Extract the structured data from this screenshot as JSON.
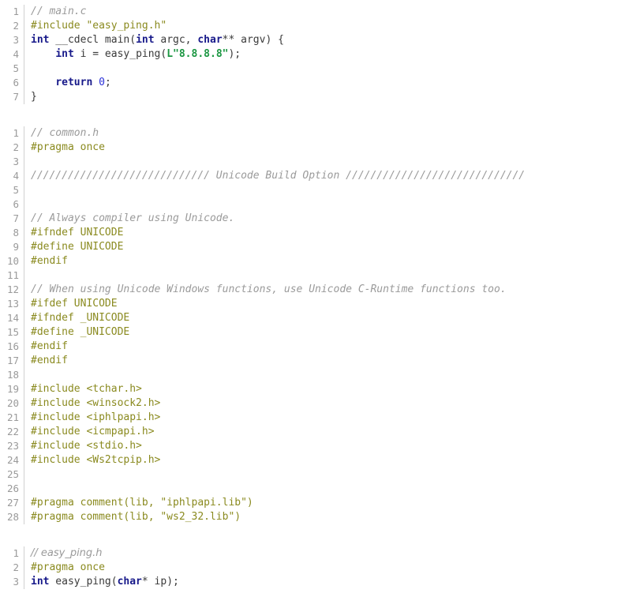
{
  "document": {
    "type": "source-code-listing",
    "language": "c",
    "background_color": "#ffffff",
    "theme": {
      "comment_color": "#9a9a9a",
      "preprocessor_color": "#8a8a1f",
      "keyword_color": "#17198a",
      "string_color": "#1a9641",
      "number_color": "#2a30d8",
      "plain_color": "#3a3a3a",
      "gutter_color": "#9a9a9a",
      "divider_color": "#d0d0d0"
    }
  },
  "blocks": [
    {
      "id": "block-main-c",
      "file_label": "main.c",
      "line_numbers": [
        "1",
        "2",
        "3",
        "4",
        "5",
        "6",
        "7"
      ],
      "lines": [
        {
          "number": "1",
          "text": "// main.c",
          "tokens": [
            {
              "t": "// main.c",
              "k": "comment"
            }
          ]
        },
        {
          "number": "2",
          "text": "#include \"easy_ping.h\"",
          "tokens": [
            {
              "t": "#include \"easy_ping.h\"",
              "k": "preproc"
            }
          ]
        },
        {
          "number": "3",
          "text": "int __cdecl main(int argc, char** argv) {",
          "tokens": [
            {
              "t": "int",
              "k": "keyword"
            },
            {
              "t": " __cdecl main(",
              "k": "plain"
            },
            {
              "t": "int",
              "k": "keyword"
            },
            {
              "t": " argc, ",
              "k": "plain"
            },
            {
              "t": "char",
              "k": "keyword"
            },
            {
              "t": "** argv) {",
              "k": "plain"
            }
          ]
        },
        {
          "number": "4",
          "text": "    int i = easy_ping(L\"8.8.8.8\");",
          "tokens": [
            {
              "t": "    ",
              "k": "plain"
            },
            {
              "t": "int",
              "k": "keyword"
            },
            {
              "t": " i = easy_ping(",
              "k": "plain"
            },
            {
              "t": "L\"8.8.8.8\"",
              "k": "string"
            },
            {
              "t": ");",
              "k": "plain"
            }
          ]
        },
        {
          "number": "5",
          "text": "",
          "tokens": []
        },
        {
          "number": "6",
          "text": "    return 0;",
          "tokens": [
            {
              "t": "    ",
              "k": "plain"
            },
            {
              "t": "return",
              "k": "keyword"
            },
            {
              "t": " ",
              "k": "plain"
            },
            {
              "t": "0",
              "k": "number"
            },
            {
              "t": ";",
              "k": "plain"
            }
          ]
        },
        {
          "number": "7",
          "text": "}",
          "tokens": [
            {
              "t": "}",
              "k": "plain"
            }
          ]
        }
      ]
    },
    {
      "id": "block-common-h",
      "file_label": "common.h",
      "line_numbers": [
        "1",
        "2",
        "3",
        "4",
        "5",
        "6",
        "7",
        "8",
        "9",
        "10",
        "11",
        "12",
        "13",
        "14",
        "15",
        "16",
        "17",
        "18",
        "19",
        "20",
        "21",
        "22",
        "23",
        "24",
        "25",
        "26",
        "27",
        "28"
      ],
      "lines": [
        {
          "number": "1",
          "text": "// common.h",
          "tokens": [
            {
              "t": "// common.h",
              "k": "comment"
            }
          ]
        },
        {
          "number": "2",
          "text": "#pragma once",
          "tokens": [
            {
              "t": "#pragma once",
              "k": "preproc"
            }
          ]
        },
        {
          "number": "3",
          "text": "",
          "tokens": []
        },
        {
          "number": "4",
          "text": "///////////////////////////// Unicode Build Option /////////////////////////////",
          "tokens": [
            {
              "t": "///////////////////////////// Unicode Build Option /////////////////////////////",
              "k": "comment"
            }
          ]
        },
        {
          "number": "5",
          "text": "",
          "tokens": []
        },
        {
          "number": "6",
          "text": "",
          "tokens": []
        },
        {
          "number": "7",
          "text": "// Always compiler using Unicode.",
          "tokens": [
            {
              "t": "// Always compiler using Unicode.",
              "k": "comment"
            }
          ]
        },
        {
          "number": "8",
          "text": "#ifndef UNICODE",
          "tokens": [
            {
              "t": "#ifndef UNICODE",
              "k": "preproc"
            }
          ]
        },
        {
          "number": "9",
          "text": "#define UNICODE",
          "tokens": [
            {
              "t": "#define UNICODE",
              "k": "preproc"
            }
          ]
        },
        {
          "number": "10",
          "text": "#endif",
          "tokens": [
            {
              "t": "#endif",
              "k": "preproc"
            }
          ]
        },
        {
          "number": "11",
          "text": "",
          "tokens": []
        },
        {
          "number": "12",
          "text": "// When using Unicode Windows functions, use Unicode C-Runtime functions too.",
          "tokens": [
            {
              "t": "// When using Unicode Windows functions, use Unicode C-Runtime functions too.",
              "k": "comment"
            }
          ]
        },
        {
          "number": "13",
          "text": "#ifdef UNICODE",
          "tokens": [
            {
              "t": "#ifdef UNICODE",
              "k": "preproc"
            }
          ]
        },
        {
          "number": "14",
          "text": "#ifndef _UNICODE",
          "tokens": [
            {
              "t": "#ifndef _UNICODE",
              "k": "preproc"
            }
          ]
        },
        {
          "number": "15",
          "text": "#define _UNICODE",
          "tokens": [
            {
              "t": "#define _UNICODE",
              "k": "preproc"
            }
          ]
        },
        {
          "number": "16",
          "text": "#endif",
          "tokens": [
            {
              "t": "#endif",
              "k": "preproc"
            }
          ]
        },
        {
          "number": "17",
          "text": "#endif",
          "tokens": [
            {
              "t": "#endif",
              "k": "preproc"
            }
          ]
        },
        {
          "number": "18",
          "text": "",
          "tokens": []
        },
        {
          "number": "19",
          "text": "#include <tchar.h>",
          "tokens": [
            {
              "t": "#include <tchar.h>",
              "k": "preproc"
            }
          ]
        },
        {
          "number": "20",
          "text": "#include <winsock2.h>",
          "tokens": [
            {
              "t": "#include <winsock2.h>",
              "k": "preproc"
            }
          ]
        },
        {
          "number": "21",
          "text": "#include <iphlpapi.h>",
          "tokens": [
            {
              "t": "#include <iphlpapi.h>",
              "k": "preproc"
            }
          ]
        },
        {
          "number": "22",
          "text": "#include <icmpapi.h>",
          "tokens": [
            {
              "t": "#include <icmpapi.h>",
              "k": "preproc"
            }
          ]
        },
        {
          "number": "23",
          "text": "#include <stdio.h>",
          "tokens": [
            {
              "t": "#include <stdio.h>",
              "k": "preproc"
            }
          ]
        },
        {
          "number": "24",
          "text": "#include <Ws2tcpip.h>",
          "tokens": [
            {
              "t": "#include <Ws2tcpip.h>",
              "k": "preproc"
            }
          ]
        },
        {
          "number": "25",
          "text": "",
          "tokens": []
        },
        {
          "number": "26",
          "text": "",
          "tokens": []
        },
        {
          "number": "27",
          "text": "#pragma comment(lib, \"iphlpapi.lib\")",
          "tokens": [
            {
              "t": "#pragma comment(lib, \"iphlpapi.lib\")",
              "k": "preproc"
            }
          ]
        },
        {
          "number": "28",
          "text": "#pragma comment(lib, \"ws2_32.lib\")",
          "tokens": [
            {
              "t": "#pragma comment(lib, \"ws2_32.lib\")",
              "k": "preproc"
            }
          ]
        }
      ]
    },
    {
      "id": "block-easy-ping-h",
      "file_label": "easy_ping.h",
      "line_numbers": [
        "1",
        "2",
        "3"
      ],
      "lines": [
        {
          "number": "1",
          "text": "// easy_ping.h",
          "tokens": [
            {
              "t": "// easy_ping.h",
              "k": "comment-prop"
            }
          ]
        },
        {
          "number": "2",
          "text": "#pragma once",
          "tokens": [
            {
              "t": "#pragma once",
              "k": "preproc"
            }
          ]
        },
        {
          "number": "3",
          "text": "int easy_ping(char* ip);",
          "tokens": [
            {
              "t": "int",
              "k": "keyword"
            },
            {
              "t": " easy_ping(",
              "k": "plain"
            },
            {
              "t": "char",
              "k": "keyword"
            },
            {
              "t": "* ip);",
              "k": "plain"
            }
          ]
        }
      ]
    }
  ]
}
